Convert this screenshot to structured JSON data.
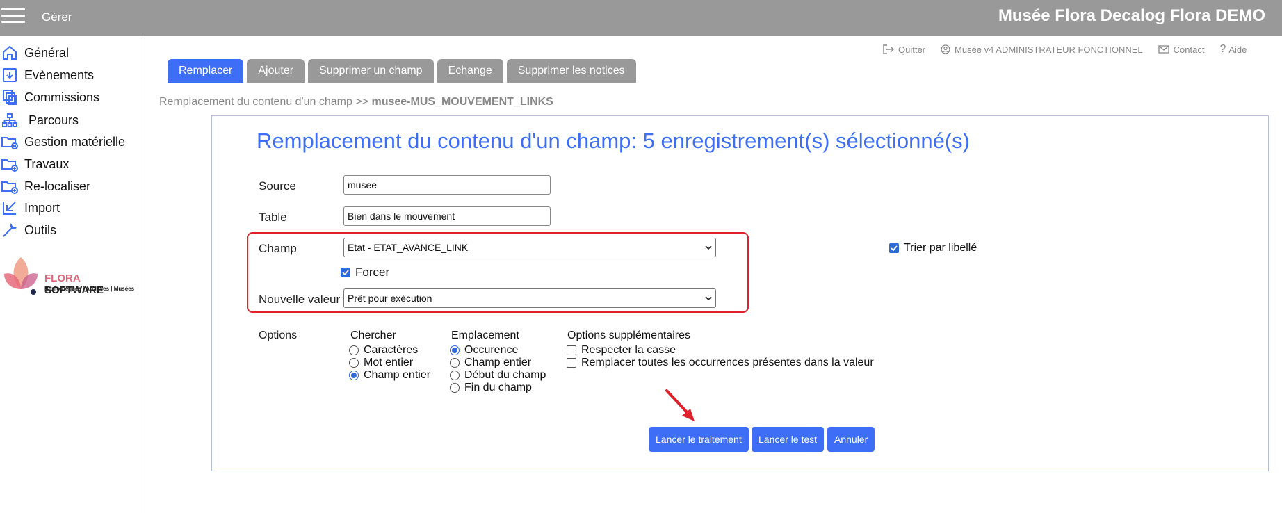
{
  "topbar": {
    "menu_label": "Gérer",
    "app_title": "Musée Flora Decalog Flora DEMO"
  },
  "sidebar": {
    "items": [
      {
        "label": "Général",
        "icon": "home-icon"
      },
      {
        "label": "Evènements",
        "icon": "calendar-download-icon"
      },
      {
        "label": "Commissions",
        "icon": "documents-icon"
      },
      {
        "label": "Parcours",
        "icon": "sitemap-icon"
      },
      {
        "label": "Gestion matérielle",
        "icon": "folder-add-icon"
      },
      {
        "label": "Travaux",
        "icon": "folder-add-icon"
      },
      {
        "label": "Re-localiser",
        "icon": "folder-add-icon"
      },
      {
        "label": "Import",
        "icon": "import-arrow-icon"
      },
      {
        "label": "Outils",
        "icon": "wrench-icon"
      }
    ],
    "logo": {
      "brand_a": "FLORA",
      "brand_b": " SOFTWARE",
      "tagline": "Bibliothèques | Archives | Musées"
    }
  },
  "header_links": {
    "quit": "Quitter",
    "user": "Musée v4 ADMINISTRATEUR FONCTIONNEL",
    "contact": "Contact",
    "help": "Aide"
  },
  "tabs": [
    {
      "label": "Remplacer",
      "active": true
    },
    {
      "label": "Ajouter",
      "active": false
    },
    {
      "label": "Supprimer un champ",
      "active": false
    },
    {
      "label": "Echange",
      "active": false
    },
    {
      "label": "Supprimer les notices",
      "active": false
    }
  ],
  "breadcrumb": {
    "path": "Remplacement du contenu d'un champ >> ",
    "current": "musee-MUS_MOUVEMENT_LINKS"
  },
  "form": {
    "title": "Remplacement du contenu d'un champ: 5 enregistrement(s) sélectionné(s)",
    "source_label": "Source",
    "source_value": "musee",
    "table_label": "Table",
    "table_value": "Bien dans le mouvement",
    "champ_label": "Champ",
    "champ_value": "Etat - ETAT_AVANCE_LINK",
    "sort_label": "Trier par libellé",
    "sort_checked": true,
    "force_label": "Forcer",
    "force_checked": true,
    "new_value_label": "Nouvelle valeur",
    "new_value": "Prêt pour exécution",
    "options_label": "Options",
    "search": {
      "heading": "Chercher",
      "options": [
        "Caractères",
        "Mot entier",
        "Champ entier"
      ],
      "selected": "Champ entier"
    },
    "location": {
      "heading": "Emplacement",
      "options": [
        "Occurence",
        "Champ entier",
        "Début du champ",
        "Fin du champ"
      ],
      "selected": "Occurence"
    },
    "extra": {
      "heading": "Options supplémentaires",
      "options": [
        "Respecter la casse",
        "Remplacer toutes les occurrences présentes dans la valeur"
      ]
    }
  },
  "buttons": {
    "run": "Lancer le traitement",
    "test": "Lancer le test",
    "cancel": "Annuler"
  },
  "colors": {
    "accent": "#3d6ef5",
    "topbar": "#999999",
    "highlight": "#e0202a"
  }
}
